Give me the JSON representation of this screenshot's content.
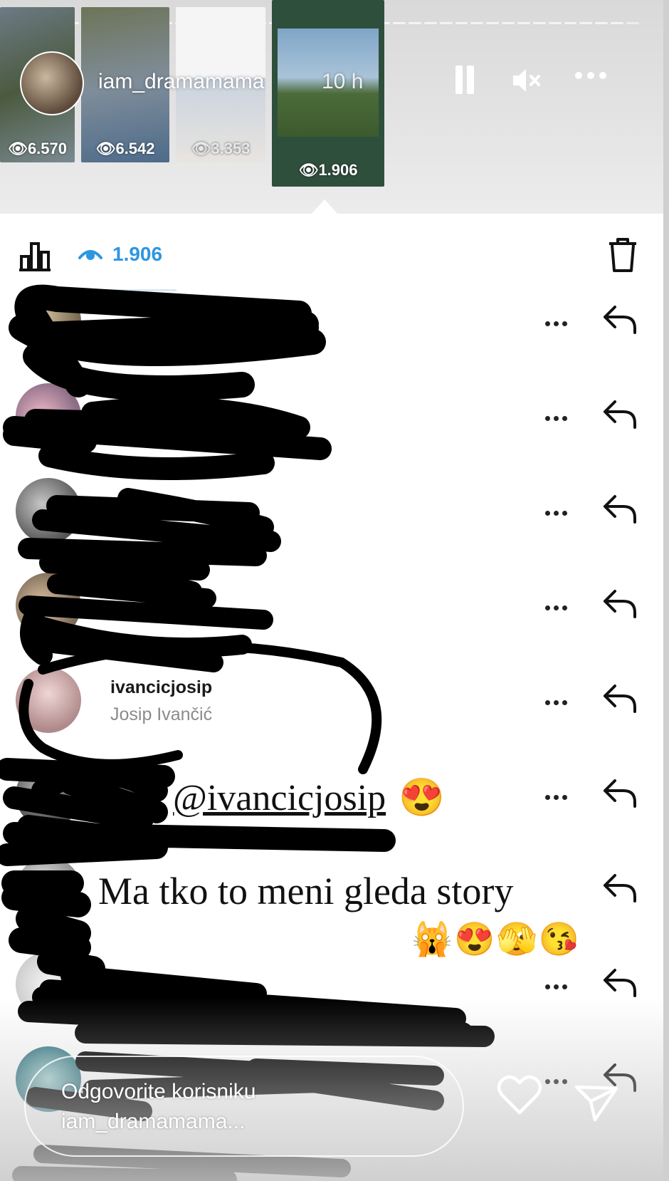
{
  "story": {
    "username": "iam_dramamama",
    "time_ago": "10 h",
    "progress_segments": 40,
    "thumbnails": [
      {
        "views": "6.570"
      },
      {
        "views": "6.542"
      },
      {
        "views": "3.353"
      },
      {
        "views": "1.906",
        "selected": true
      }
    ],
    "controls": {
      "pause": "pause-icon",
      "mute": "muted-speaker-icon",
      "more": "more-horizontal-icon"
    }
  },
  "viewers_panel": {
    "views_count": "1.906",
    "icons": {
      "stats": "bar-chart-icon",
      "views": "eye-icon",
      "delete": "trash-icon"
    },
    "viewers": [
      {
        "username": "",
        "full_name": "",
        "redacted": true
      },
      {
        "username": "",
        "full_name": "",
        "redacted": true
      },
      {
        "username": "",
        "full_name": "",
        "redacted": true
      },
      {
        "username": "",
        "full_name": "",
        "redacted": true
      },
      {
        "username": "ivancicjosip",
        "full_name": "Josip Ivančić",
        "redacted": false
      },
      {
        "username": "",
        "full_name": "",
        "redacted": true
      },
      {
        "username": "",
        "full_name": "",
        "redacted": true
      },
      {
        "username": "",
        "full_name": "",
        "redacted": true
      },
      {
        "username": "",
        "full_name": "",
        "redacted": true
      }
    ]
  },
  "stickers": {
    "mention": "@ivancicjosip",
    "mention_emoji": "😍",
    "caption": "Ma tko to meni gleda story",
    "caption_emojis": "🙀😍🫣😘"
  },
  "reply_bar": {
    "placeholder": "Odgovorite korisniku iam_dramamama..."
  },
  "colors": {
    "accent_blue": "#2d96e0",
    "redaction": "#000000"
  }
}
